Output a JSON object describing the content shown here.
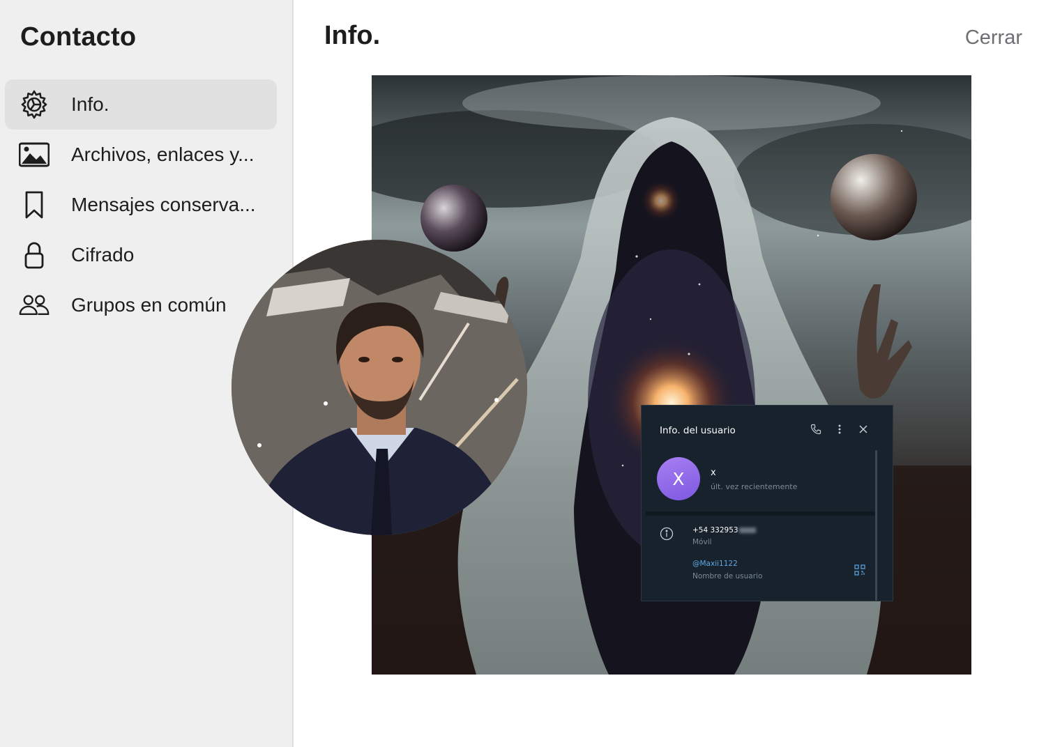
{
  "sidebar": {
    "title": "Contacto",
    "items": [
      {
        "label": "Info.",
        "icon": "gear-icon",
        "active": true
      },
      {
        "label": "Archivos, enlaces y...",
        "icon": "image-icon",
        "active": false
      },
      {
        "label": "Mensajes conserva...",
        "icon": "bookmark-icon",
        "active": false
      },
      {
        "label": "Cifrado",
        "icon": "lock-icon",
        "active": false
      },
      {
        "label": "Grupos en común",
        "icon": "people-icon",
        "active": false
      }
    ]
  },
  "main": {
    "title": "Info.",
    "close_label": "Cerrar"
  },
  "telegram_card": {
    "title": "Info. del usuario",
    "avatar_letter": "X",
    "name": "x",
    "status": "últ. vez recientemente",
    "phone": "+54 332953",
    "phone_label": "Móvil",
    "username": "@Maxii1122",
    "username_label": "Nombre de usuario",
    "avatar_color": "#8f6aea",
    "background_color": "#18222d",
    "link_color": "#5ea9e6"
  },
  "colors": {
    "sidebar_bg": "#efefef",
    "active_item_bg": "#e1e1e1",
    "close_text": "#6e6e73"
  }
}
